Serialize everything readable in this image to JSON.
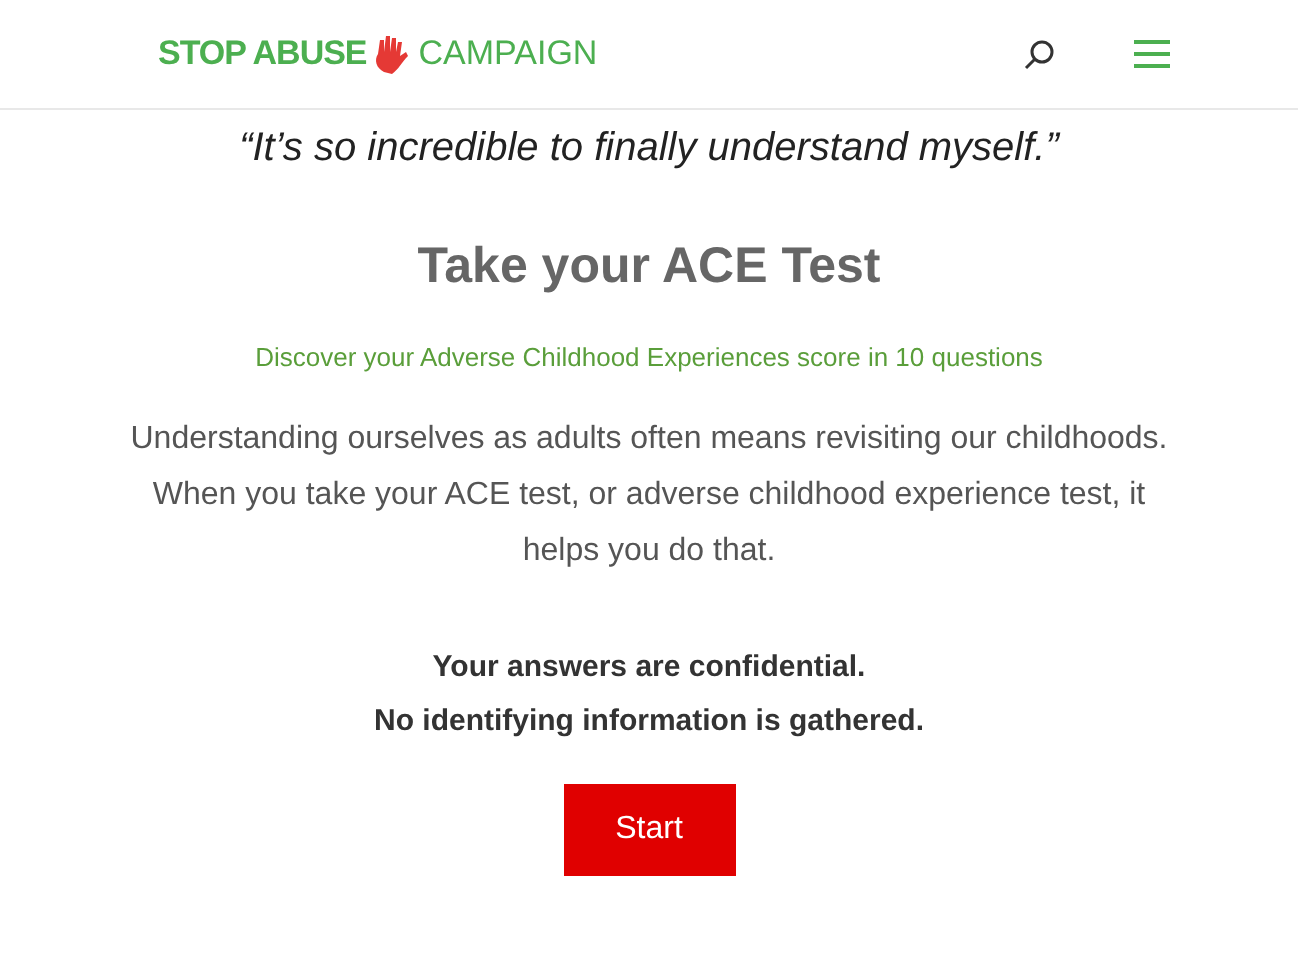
{
  "header": {
    "logo_bold": "STOP ABUSE",
    "logo_light": "CAMPAIGN"
  },
  "quote": "“It’s so incredible to finally understand myself.”",
  "title": "Take your ACE Test",
  "subtitle": "Discover your Adverse Childhood Experiences score in 10 questions",
  "intro": "Understanding ourselves as adults often means revisiting our childhoods. When you take your ACE test, or adverse childhood experience test, it helps you do that.",
  "notes": [
    "Your answers are confidential.",
    "No identifying information is gathered."
  ],
  "button": "Start"
}
